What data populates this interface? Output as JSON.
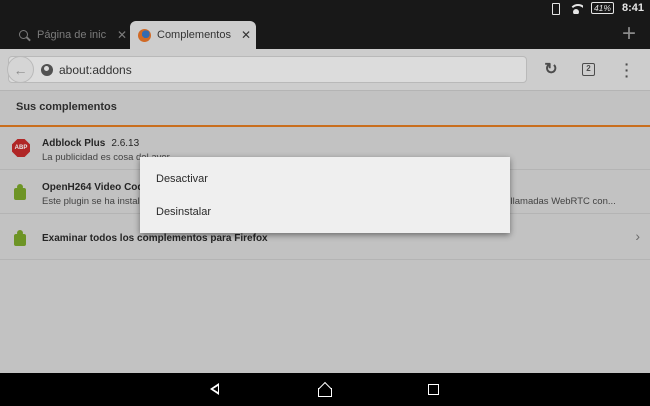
{
  "status_bar": {
    "battery": "41%",
    "time": "8:41"
  },
  "tabs": [
    {
      "label": "Página de inic",
      "close": "✕",
      "icon": "search-icon",
      "active": false
    },
    {
      "label": "Complementos",
      "close": "✕",
      "icon": "firefox-icon",
      "active": true
    }
  ],
  "new_tab": "+",
  "toolbar": {
    "url": "about:addons",
    "tab_count": "2"
  },
  "content": {
    "section_title": "Sus complementos",
    "addons": [
      {
        "name": "Adblock Plus",
        "version": "2.6.13",
        "description": "La publicidad es cosa del ayer",
        "icon": "adblock-plus-icon",
        "icon_text": "ABP"
      },
      {
        "name": "OpenH264 Video Codec provided by Cisco Systems, Inc.",
        "version": "",
        "description": "Este plugin se ha instalado automáticamente por Mozilla para cumplir con la especificación WebRTC y permitir llamadas WebRTC con...",
        "icon": "puzzle-piece-icon"
      }
    ],
    "browse_all": "Examinar todos los complementos para Firefox"
  },
  "dialog": {
    "items": [
      "Desactivar",
      "Desinstalar"
    ]
  },
  "colors": {
    "accent": "#e07b21",
    "tab_strip": "#1b1b1b",
    "toolbar": "#e5e5e5"
  }
}
